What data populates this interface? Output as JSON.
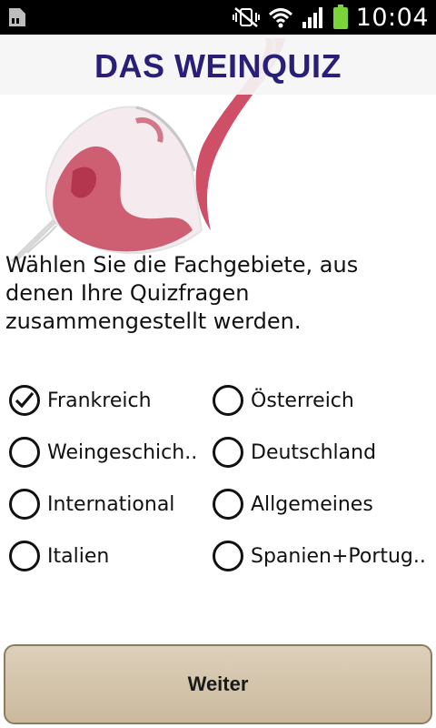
{
  "status": {
    "time": "10:04"
  },
  "header": {
    "title": "DAS WEINQUIZ"
  },
  "instruction": "Wählen Sie die Fachgebiete, aus denen Ihre Quizfragen zusammengestellt werden.",
  "options": [
    {
      "label": "Frankreich",
      "checked": true
    },
    {
      "label": "Österreich",
      "checked": false
    },
    {
      "label": "Weingeschich..",
      "checked": false
    },
    {
      "label": "Deutschland",
      "checked": false
    },
    {
      "label": "International",
      "checked": false
    },
    {
      "label": "Allgemeines",
      "checked": false
    },
    {
      "label": "Italien",
      "checked": false
    },
    {
      "label": "Spanien+Portug..",
      "checked": false
    }
  ],
  "button": {
    "label": "Weiter"
  },
  "colors": {
    "title": "#2a1f78",
    "button_bg": "#d3c4aa",
    "button_border": "#8b7d63",
    "wine": "#c0304a",
    "battery": "#7bd43a"
  },
  "icons": [
    "sd-card-icon",
    "mute-vibrate-icon",
    "wifi-icon",
    "signal-icon",
    "battery-icon",
    "wine-glass-illustration"
  ]
}
